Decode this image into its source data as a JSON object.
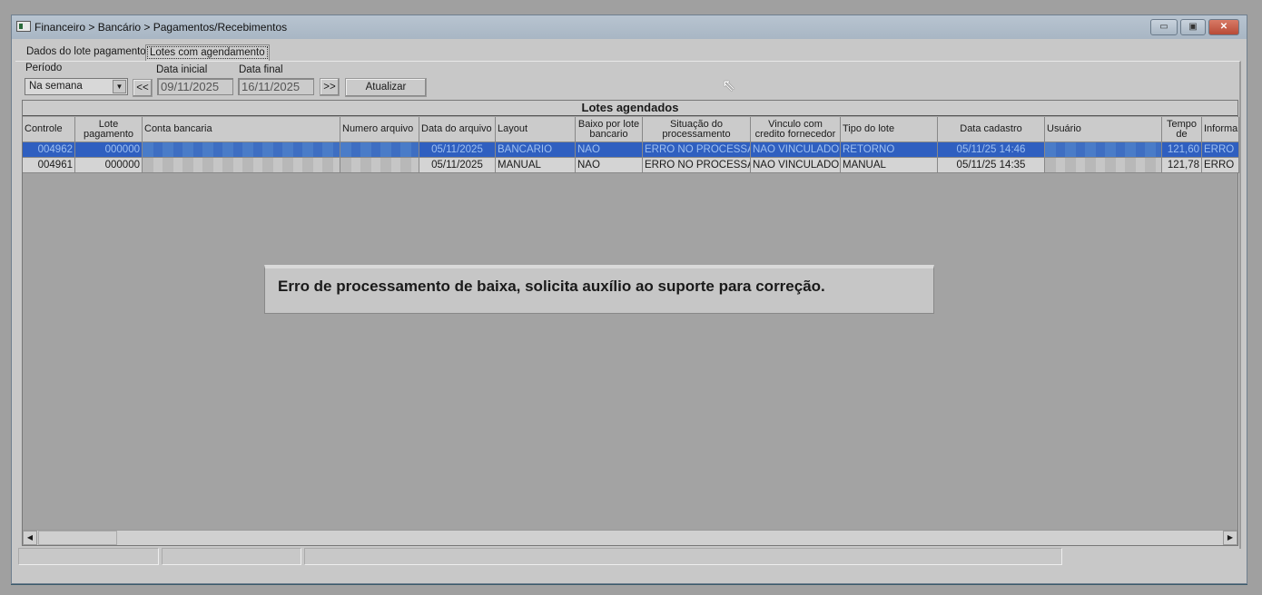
{
  "window": {
    "title": "Financeiro > Bancário > Pagamentos/Recebimentos",
    "minimize": "▭",
    "maximize": "▣",
    "close": "✕"
  },
  "tabs": [
    {
      "label": "Dados do lote pagamento"
    },
    {
      "label": "Lotes com agendamento"
    }
  ],
  "filters": {
    "periodo_label": "Período",
    "periodo_value": "Na semana",
    "prev": "<<",
    "next": ">>",
    "data_inicial_label": "Data inicial",
    "data_inicial": "09/11/2025",
    "data_final_label": "Data final",
    "data_final": "16/11/2025",
    "atualizar": "Atualizar"
  },
  "grid": {
    "title": "Lotes agendados",
    "columns": [
      "Controle",
      "Lote pagamento",
      "Conta bancaria",
      "Numero arquivo",
      "Data do arquivo",
      "Layout",
      "Baixo por lote bancario",
      "Situação do processamento",
      "Vinculo com credito fornecedor",
      "Tipo do lote",
      "Data cadastro",
      "Usuário",
      "Tempo de",
      "Informa"
    ],
    "rows": [
      [
        "004962",
        "000000",
        "",
        "",
        "05/11/2025",
        "BANCARIO",
        "NAO",
        "ERRO NO PROCESSAI",
        "NAO VINCULADO",
        "RETORNO",
        "05/11/25 14:46",
        "",
        "121,60",
        "ERRO"
      ],
      [
        "004961",
        "000000",
        "",
        "",
        "05/11/2025",
        "MANUAL",
        "NAO",
        "ERRO NO PROCESSAI",
        "NAO VINCULADO",
        "MANUAL",
        "05/11/25 14:35",
        "",
        "121,78",
        "ERRO"
      ]
    ]
  },
  "message": "Erro de processamento de baixa, solicita auxílio ao suporte para correção.",
  "colors": {
    "selected_row": "#2f5fc0",
    "background": "#a0a0a0"
  }
}
